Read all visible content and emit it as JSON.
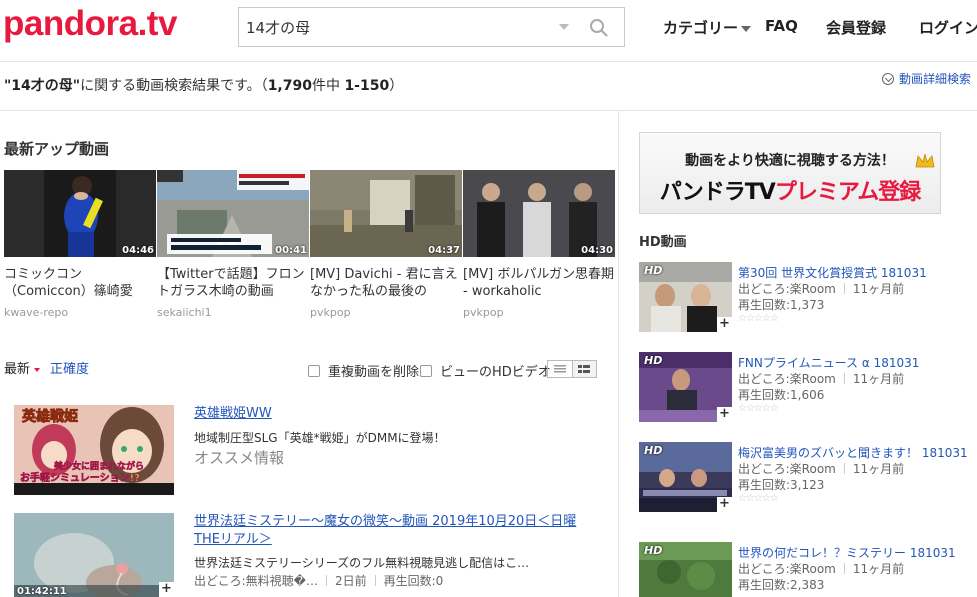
{
  "header": {
    "logo": "pandora.tv",
    "search_value": "14才の母",
    "nav": {
      "category": "カテゴリー",
      "faq": "FAQ",
      "register": "会員登録",
      "login": "ログイン"
    }
  },
  "results": {
    "prefix": "\"14才の母\"",
    "middle": "に関する動画検索結果です。（",
    "total": "1,790",
    "count_label": "件中",
    "range": "1-150",
    "suffix": "）",
    "advanced_search": "動画詳細検索"
  },
  "latest": {
    "title": "最新アップ動画",
    "items": [
      {
        "duration": "04:46",
        "title": "コミックコン （Comiccon）篠崎愛",
        "user": "kwave-repo"
      },
      {
        "duration": "00:41",
        "title": "【Twitterで話題】フロントガラス木崎の動画",
        "user": "sekaiichi1"
      },
      {
        "duration": "04:37",
        "title": "[MV] Davichi - 君に言えなかった私の最後の",
        "user": "pvkpop"
      },
      {
        "duration": "04:30",
        "title": "[MV] ボルパルガン思春期 - workaholic",
        "user": "pvkpop"
      }
    ]
  },
  "sort": {
    "latest": "最新",
    "relevance": "正確度",
    "dedupe": "重複動画を削除",
    "hd_only": "ビューのHDビデオ"
  },
  "list": [
    {
      "title": "英雄戦姫WW",
      "desc": "地域制圧型SLG「英雄*戦姫」がDMMに登場！",
      "ad": "オススメ情報",
      "thumb_text_1": "英雄戦姫",
      "thumb_text_2": "美少女に囲まれながら",
      "thumb_text_3": "お手軽シミュレーション!?"
    },
    {
      "title": "世界法廷ミステリー〜魔女の微笑〜動画 2019年10月20日＜日曜THEリアル＞",
      "desc": "世界法廷ミステリーシリーズのフル無料視聴見逃し配信はこ…",
      "source": "出どころ:無料視聴�…",
      "age": "2日前",
      "views": "再生回数:0",
      "duration": "01:42:11"
    }
  ],
  "sidebar": {
    "banner_line1": "動画をより快適に視聴する方法！",
    "banner_line2a": "パンドラTV",
    "banner_line2b": "プレミアム登録",
    "hd_title": "HD動画",
    "hd_badge": "HD",
    "items": [
      {
        "title": "第30回 世界文化賞授賞式 181031",
        "source": "出どころ:楽Room",
        "age": "11ヶ月前",
        "views": "再生回数:1,373"
      },
      {
        "title": "FNNプライムニュース α 181031",
        "source": "出どころ:楽Room",
        "age": "11ヶ月前",
        "views": "再生回数:1,606"
      },
      {
        "title": "梅沢富美男のズバッと聞きます！ 181031",
        "source": "出どころ:楽Room",
        "age": "11ヶ月前",
        "views": "再生回数:3,123"
      },
      {
        "title": "世界の何だコレ！？ミステリー 181031",
        "source": "出どころ:楽Room",
        "age": "11ヶ月前",
        "views": "再生回数:2,383"
      }
    ]
  },
  "colors": {
    "brand": "#e8193e",
    "link": "#2255bb"
  }
}
